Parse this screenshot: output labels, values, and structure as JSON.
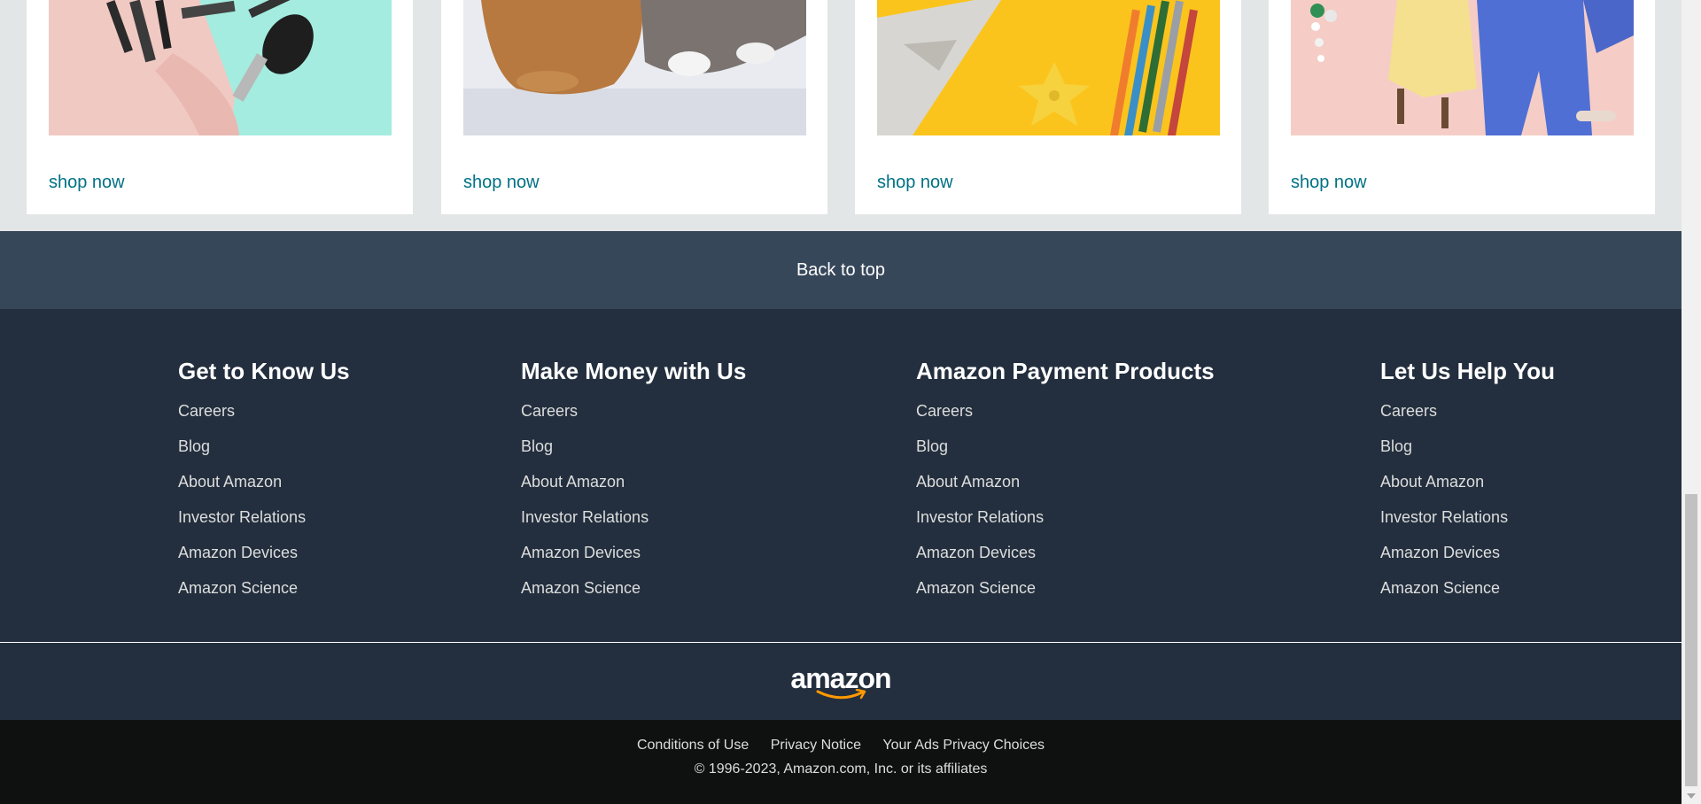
{
  "cards": [
    {
      "image": "makeup-bag-with-brushes",
      "shop_label": "shop now"
    },
    {
      "image": "dog-and-cat-on-floor",
      "shop_label": "shop now"
    },
    {
      "image": "toy-plane-and-colored-pencils",
      "shop_label": "shop now"
    },
    {
      "image": "women-fashion-outfits",
      "shop_label": "shop now"
    }
  ],
  "back_to_top": "Back to top",
  "columns": [
    {
      "title": "Get to Know Us",
      "links": [
        "Careers",
        "Blog",
        "About Amazon",
        "Investor Relations",
        "Amazon Devices",
        "Amazon Science"
      ]
    },
    {
      "title": "Make Money with Us",
      "links": [
        "Careers",
        "Blog",
        "About Amazon",
        "Investor Relations",
        "Amazon Devices",
        "Amazon Science"
      ]
    },
    {
      "title": "Amazon Payment Products",
      "links": [
        "Careers",
        "Blog",
        "About Amazon",
        "Investor Relations",
        "Amazon Devices",
        "Amazon Science"
      ]
    },
    {
      "title": "Let Us Help You",
      "links": [
        "Careers",
        "Blog",
        "About Amazon",
        "Investor Relations",
        "Amazon Devices",
        "Amazon Science"
      ]
    }
  ],
  "logo": {
    "text": "amazon",
    "accent": "#ff9900"
  },
  "legal": {
    "links": [
      "Conditions of Use",
      "Privacy Notice",
      "Your Ads Privacy Choices"
    ],
    "copyright": "© 1996-2023, Amazon.com, Inc. or its affiliates"
  },
  "colors": {
    "link_teal": "#007185",
    "back_to_top_bg": "#37475a",
    "footer_bg": "#232f3e",
    "legal_bg": "#0f1111"
  }
}
